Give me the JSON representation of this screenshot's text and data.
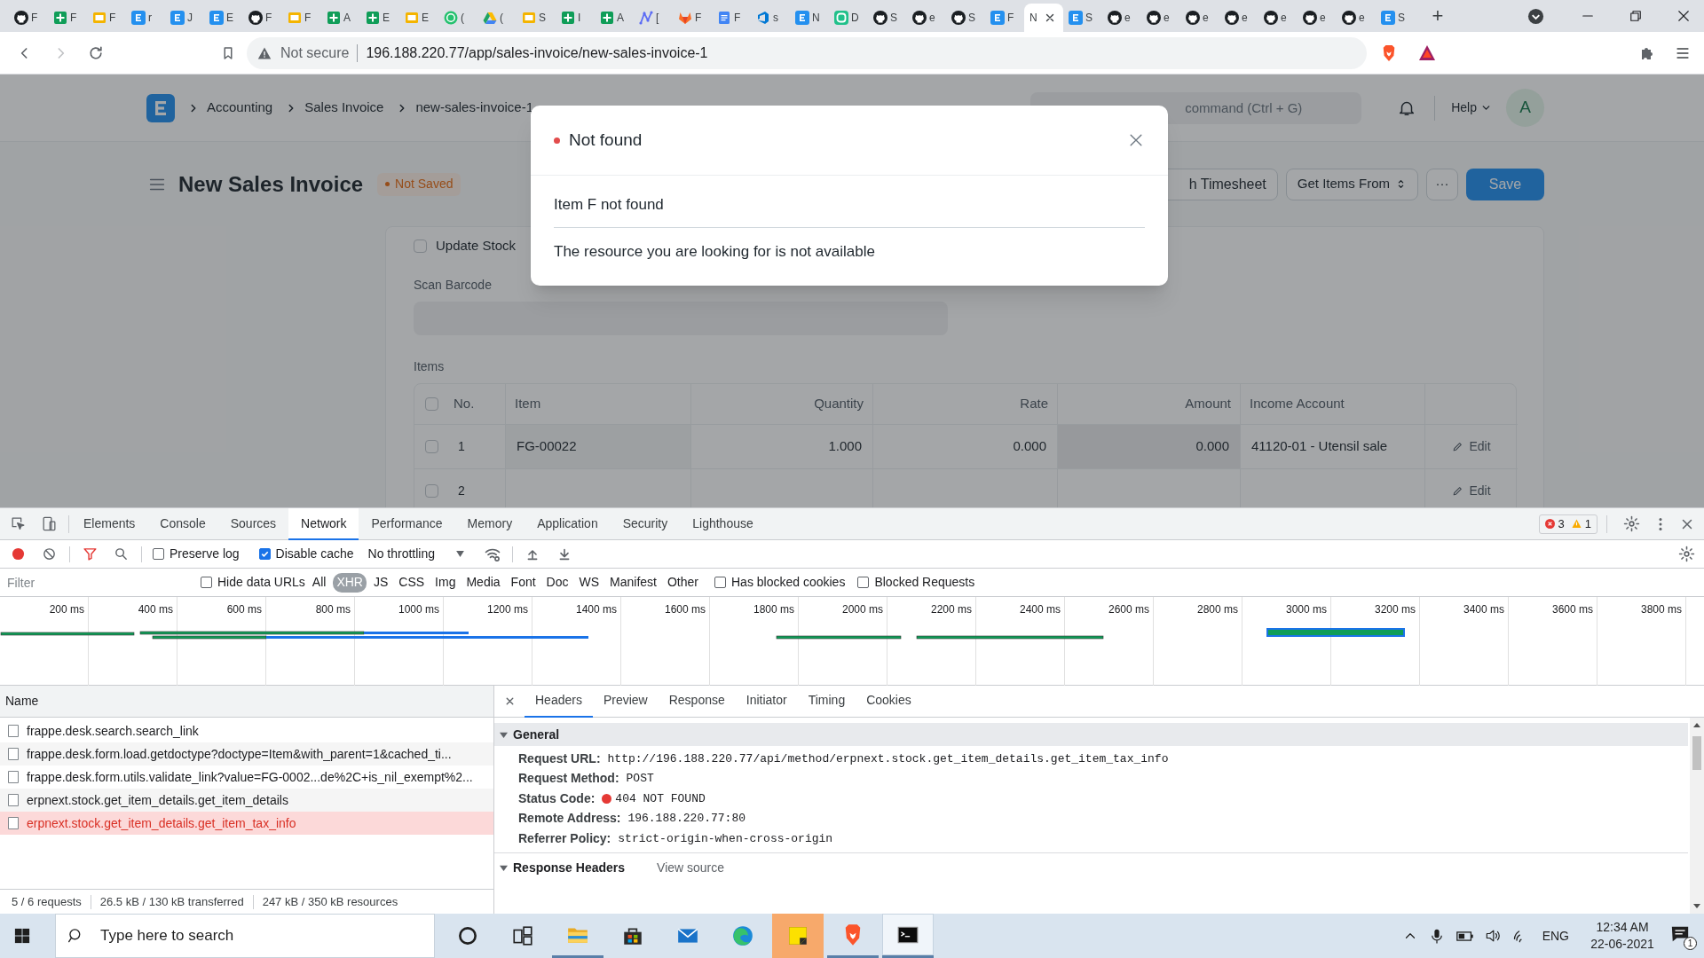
{
  "browser": {
    "tabs": [
      {
        "kind": "round",
        "label": "F",
        "selected": false
      },
      {
        "kind": "sheet",
        "label": "F",
        "selected": false
      },
      {
        "kind": "slide",
        "label": "F",
        "selected": false
      },
      {
        "kind": "app",
        "label": "r",
        "selected": false
      },
      {
        "kind": "app",
        "label": "J",
        "selected": false
      },
      {
        "kind": "app",
        "label": "E",
        "selected": false
      },
      {
        "kind": "round",
        "label": "F",
        "selected": false
      },
      {
        "kind": "slide",
        "label": "F",
        "selected": false
      },
      {
        "kind": "sheet",
        "label": "A",
        "selected": false
      },
      {
        "kind": "sheet",
        "label": "E",
        "selected": false
      },
      {
        "kind": "slide",
        "label": "E",
        "selected": false
      },
      {
        "kind": "ring",
        "label": "(",
        "selected": false
      },
      {
        "kind": "triangle",
        "label": "(",
        "selected": false
      },
      {
        "kind": "slide",
        "label": "S",
        "selected": false
      },
      {
        "kind": "sheet",
        "label": "I",
        "selected": false
      },
      {
        "kind": "sheet",
        "label": "A",
        "selected": false
      },
      {
        "kind": "graph",
        "label": "[",
        "selected": false
      },
      {
        "kind": "fox",
        "label": "F",
        "selected": false
      },
      {
        "kind": "doc",
        "label": "F",
        "selected": false
      },
      {
        "kind": "wedge",
        "label": "s",
        "selected": false
      },
      {
        "kind": "app",
        "label": "N",
        "selected": false
      },
      {
        "kind": "square",
        "label": "D",
        "selected": false
      },
      {
        "kind": "round",
        "label": "S",
        "selected": false
      },
      {
        "kind": "round",
        "label": "e",
        "selected": false
      },
      {
        "kind": "round",
        "label": "S",
        "selected": false
      },
      {
        "kind": "app",
        "label": "F",
        "selected": false
      },
      {
        "kind": "blank",
        "label": "N",
        "selected": true
      },
      {
        "kind": "app",
        "label": "S",
        "selected": false
      },
      {
        "kind": "round",
        "label": "e",
        "selected": false
      },
      {
        "kind": "round",
        "label": "e",
        "selected": false
      },
      {
        "kind": "round",
        "label": "e",
        "selected": false
      },
      {
        "kind": "round",
        "label": "e",
        "selected": false
      },
      {
        "kind": "round",
        "label": "e",
        "selected": false
      },
      {
        "kind": "round",
        "label": "e",
        "selected": false
      },
      {
        "kind": "round",
        "label": "e",
        "selected": false
      },
      {
        "kind": "app",
        "label": "S",
        "selected": false
      }
    ],
    "new_tab": "+",
    "address": {
      "security": "Not secure",
      "url": "196.188.220.77/app/sales-invoice/new-sales-invoice-1"
    }
  },
  "app": {
    "breadcrumbs": [
      "Accounting",
      "Sales Invoice",
      "new-sales-invoice-1"
    ],
    "search": {
      "placeholder": "command (Ctrl + G)"
    },
    "help": "Help",
    "avatar": "A",
    "title": "New Sales Invoice",
    "status": {
      "label": "Not Saved",
      "kind": "warning"
    },
    "actions": [
      {
        "label": "h Timesheet",
        "kind": "default"
      },
      {
        "label": "Get Items From",
        "kind": "dropdown"
      },
      {
        "label": "···",
        "kind": "more"
      },
      {
        "label": "Save",
        "kind": "primary"
      }
    ],
    "update_stock": {
      "label": "Update Stock",
      "checked": false
    },
    "scan_barcode": {
      "label": "Scan Barcode"
    },
    "items": {
      "label": "Items",
      "select_all": false,
      "columns": [
        "No.",
        "Item",
        "Quantity",
        "Rate",
        "Amount",
        "Income Account"
      ],
      "rows": [
        {
          "no": "1",
          "item": "FG-00022",
          "quantity": "1.000",
          "rate": "0.000",
          "amount": "0.000",
          "income_account": "41120-01 - Utensil sale",
          "edit": "Edit",
          "checked": false,
          "editing": true
        },
        {
          "no": "2",
          "edit": "Edit",
          "checked": false,
          "editing": false
        }
      ]
    }
  },
  "dialog": {
    "error": true,
    "title": "Not found",
    "message": "Item F not found",
    "detail": "The resource you are looking for is not available"
  },
  "devtools": {
    "tabs": [
      {
        "label": "Elements",
        "selected": false
      },
      {
        "label": "Console",
        "selected": false
      },
      {
        "label": "Sources",
        "selected": false
      },
      {
        "label": "Network",
        "selected": true
      },
      {
        "label": "Performance",
        "selected": false
      },
      {
        "label": "Memory",
        "selected": false
      },
      {
        "label": "Application",
        "selected": false
      },
      {
        "label": "Security",
        "selected": false
      },
      {
        "label": "Lighthouse",
        "selected": false
      }
    ],
    "errors": "3",
    "warnings": "1",
    "toolbar": {
      "recording": true,
      "preserve_log": {
        "label": "Preserve log",
        "checked": false
      },
      "disable_cache": {
        "label": "Disable cache",
        "checked": true
      },
      "throttling": "No throttling"
    },
    "filter": {
      "placeholder": "Filter",
      "hide_data_urls": {
        "label": "Hide data URLs",
        "checked": false
      },
      "types": [
        {
          "label": "All",
          "selected": false
        },
        {
          "label": "XHR",
          "selected": true
        },
        {
          "label": "JS",
          "selected": false
        },
        {
          "label": "CSS",
          "selected": false
        },
        {
          "label": "Img",
          "selected": false
        },
        {
          "label": "Media",
          "selected": false
        },
        {
          "label": "Font",
          "selected": false
        },
        {
          "label": "Doc",
          "selected": false
        },
        {
          "label": "WS",
          "selected": false
        },
        {
          "label": "Manifest",
          "selected": false
        },
        {
          "label": "Other",
          "selected": false
        }
      ],
      "has_blocked_cookies": {
        "label": "Has blocked cookies",
        "checked": false
      },
      "blocked_requests": {
        "label": "Blocked Requests",
        "checked": false
      }
    },
    "timeline_ticks": [
      "200 ms",
      "400 ms",
      "600 ms",
      "800 ms",
      "1000 ms",
      "1200 ms",
      "1400 ms",
      "1600 ms",
      "1800 ms",
      "2000 ms",
      "2200 ms",
      "2400 ms",
      "2600 ms",
      "2800 ms",
      "3000 ms",
      "3200 ms",
      "3400 ms",
      "3600 ms",
      "3800 ms"
    ],
    "requests": {
      "heading": "Name",
      "rows": [
        {
          "name": "frappe.desk.search.search_link",
          "failed": false
        },
        {
          "name": "frappe.desk.form.load.getdoctype?doctype=Item&with_parent=1&cached_ti...",
          "failed": false
        },
        {
          "name": "frappe.desk.form.utils.validate_link?value=FG-0002...de%2C+is_nil_exempt%2...",
          "failed": false
        },
        {
          "name": "erpnext.stock.get_item_details.get_item_details",
          "failed": false
        },
        {
          "name": "erpnext.stock.get_item_details.get_item_tax_info",
          "failed": true
        }
      ]
    },
    "summary": [
      "5 / 6 requests",
      "26.5 kB / 130 kB transferred",
      "247 kB / 350 kB resources"
    ],
    "detail_tabs": [
      {
        "label": "Headers",
        "selected": true
      },
      {
        "label": "Preview",
        "selected": false
      },
      {
        "label": "Response",
        "selected": false
      },
      {
        "label": "Initiator",
        "selected": false
      },
      {
        "label": "Timing",
        "selected": false
      },
      {
        "label": "Cookies",
        "selected": false
      }
    ],
    "general": {
      "heading": "General",
      "expanded": true,
      "fields": [
        {
          "label": "Request URL:",
          "value": "http://196.188.220.77/api/method/erpnext.stock.get_item_details.get_item_tax_info",
          "error": false
        },
        {
          "label": "Request Method:",
          "value": "POST",
          "error": false
        },
        {
          "label": "Status Code:",
          "value": "404 NOT FOUND",
          "error": true
        },
        {
          "label": "Remote Address:",
          "value": "196.188.220.77:80",
          "error": false
        },
        {
          "label": "Referrer Policy:",
          "value": "strict-origin-when-cross-origin",
          "error": false
        }
      ]
    },
    "response_headers": {
      "heading": "Response Headers",
      "expanded": true,
      "link": "View source"
    }
  },
  "taskbar": {
    "search_placeholder": "Type here to search",
    "apps": [
      {
        "kind": "circle",
        "running": false,
        "focused": false,
        "flashing": false
      },
      {
        "kind": "taskview",
        "running": false,
        "focused": false,
        "flashing": false
      },
      {
        "kind": "folder",
        "running": true,
        "focused": false,
        "flashing": false
      },
      {
        "kind": "bag",
        "running": false,
        "focused": false,
        "flashing": false
      },
      {
        "kind": "envelope",
        "running": false,
        "focused": false,
        "flashing": false
      },
      {
        "kind": "swirl",
        "running": false,
        "focused": false,
        "flashing": false
      },
      {
        "kind": "note",
        "running": false,
        "focused": false,
        "flashing": true
      },
      {
        "kind": "shield",
        "running": true,
        "focused": false,
        "flashing": false
      },
      {
        "kind": "terminal",
        "running": true,
        "focused": true,
        "flashing": false
      }
    ],
    "tray": {
      "language": "ENG",
      "time": "12:34 AM",
      "date": "22-06-2021",
      "notifications": "1"
    }
  }
}
